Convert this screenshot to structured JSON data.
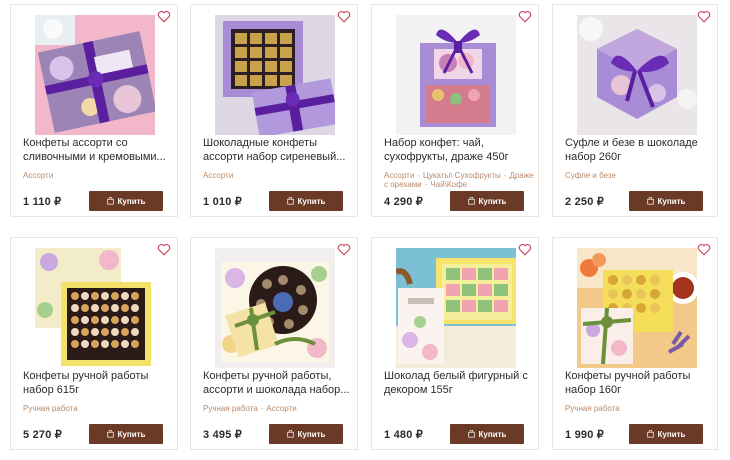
{
  "buy_label": "Купить",
  "colors": {
    "accent": "#6b3a27",
    "category": "#b88a6a",
    "heart": "#c9455b"
  },
  "products": [
    {
      "title": "Конфеты ассорти со сливочными и кремовыми...",
      "categories": [
        "Ассорти"
      ],
      "price": "1 110 ₽",
      "image_icon": "product-image"
    },
    {
      "title": "Шоколадные конфеты ассорти набор сиреневый...",
      "categories": [
        "Ассорти"
      ],
      "price": "1 010 ₽",
      "image_icon": "product-image"
    },
    {
      "title": "Набор конфет: чай, сухофрукты, драже 450г",
      "categories": [
        "Ассорти",
        "Цукаты\\ Сухофрукты",
        "Драже с орехами",
        "Чай\\Кофе"
      ],
      "price": "4 290 ₽",
      "image_icon": "product-image"
    },
    {
      "title": "Суфле и безе в шоколаде набор 260г",
      "categories": [
        "Суфле и безе"
      ],
      "price": "2 250 ₽",
      "image_icon": "product-image"
    },
    {
      "title": "Конфеты ручной работы набор 615г",
      "categories": [
        "Ручная работа"
      ],
      "price": "5 270 ₽",
      "image_icon": "product-image"
    },
    {
      "title": "Конфеты ручной работы, ассорти и шоколада набор...",
      "categories": [
        "Ручная работа",
        "Ассорти"
      ],
      "price": "3 495 ₽",
      "image_icon": "product-image"
    },
    {
      "title": "Шоколад белый фигурный с декором 155г",
      "categories": [],
      "price": "1 480 ₽",
      "image_icon": "product-image"
    },
    {
      "title": "Конфеты ручной работы набор 160г",
      "categories": [
        "Ручная работа"
      ],
      "price": "1 990 ₽",
      "image_icon": "product-image"
    }
  ]
}
